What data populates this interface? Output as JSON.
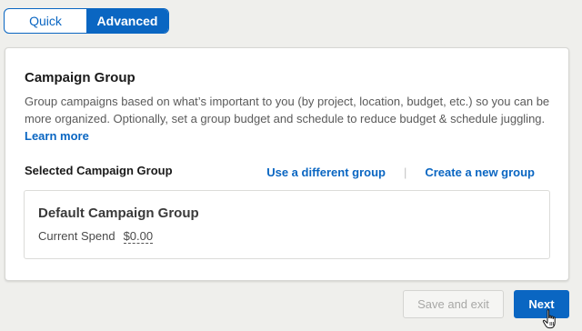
{
  "mode_toggle": {
    "quick_label": "Quick",
    "advanced_label": "Advanced",
    "selected": "Advanced"
  },
  "campaign_group": {
    "title": "Campaign Group",
    "description": "Group campaigns based on what’s important to you (by project, location, budget, etc.) so you can be more organized. Optionally, set a group budget and schedule to reduce budget & schedule juggling.",
    "learn_more_label": "Learn more",
    "selected_label": "Selected Campaign Group",
    "use_different_label": "Use a different group",
    "create_new_label": "Create a new group",
    "separator": "|",
    "selected_group": {
      "name": "Default Campaign Group",
      "spend_label": "Current Spend",
      "spend_value": "$0.00"
    }
  },
  "footer": {
    "save_exit_label": "Save and exit",
    "next_label": "Next"
  },
  "icons": {
    "cursor": "hand-pointer-icon"
  },
  "colors": {
    "accent": "#0a66c2",
    "background": "#efefec",
    "disabled_text": "#a8a8a6"
  }
}
